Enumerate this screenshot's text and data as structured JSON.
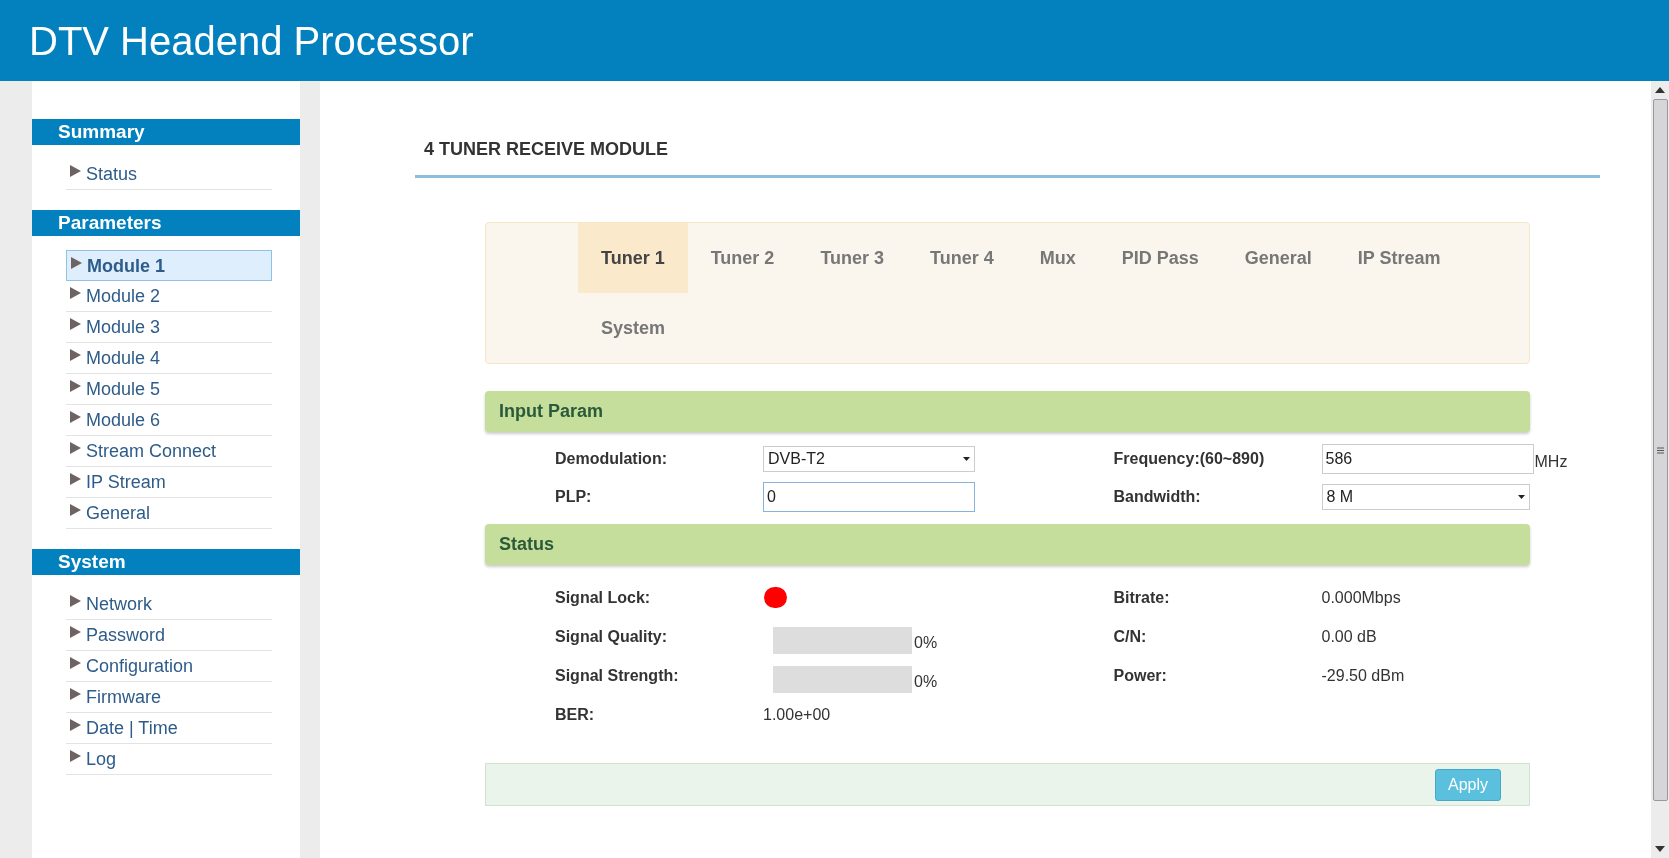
{
  "header": {
    "title": "DTV Headend Processor"
  },
  "sidebar": {
    "sections": [
      {
        "title": "Summary",
        "items": [
          {
            "label": "Status",
            "selected": false
          }
        ]
      },
      {
        "title": "Parameters",
        "items": [
          {
            "label": "Module 1",
            "selected": true
          },
          {
            "label": "Module 2",
            "selected": false
          },
          {
            "label": "Module 3",
            "selected": false
          },
          {
            "label": "Module 4",
            "selected": false
          },
          {
            "label": "Module 5",
            "selected": false
          },
          {
            "label": "Module 6",
            "selected": false
          },
          {
            "label": "Stream Connect",
            "selected": false
          },
          {
            "label": "IP Stream",
            "selected": false
          },
          {
            "label": "General",
            "selected": false
          }
        ]
      },
      {
        "title": "System",
        "items": [
          {
            "label": "Network",
            "selected": false
          },
          {
            "label": "Password",
            "selected": false
          },
          {
            "label": "Configuration",
            "selected": false
          },
          {
            "label": "Firmware",
            "selected": false
          },
          {
            "label": "Date | Time",
            "selected": false
          },
          {
            "label": "Log",
            "selected": false
          }
        ]
      }
    ]
  },
  "page_title": "4 TUNER RECEIVE MODULE",
  "tabs": [
    {
      "label": "Tuner 1",
      "selected": true
    },
    {
      "label": "Tuner 2",
      "selected": false
    },
    {
      "label": "Tuner 3",
      "selected": false
    },
    {
      "label": "Tuner 4",
      "selected": false
    },
    {
      "label": "Mux",
      "selected": false
    },
    {
      "label": "PID Pass",
      "selected": false
    },
    {
      "label": "General",
      "selected": false
    },
    {
      "label": "IP Stream",
      "selected": false
    },
    {
      "label": "System",
      "selected": false
    }
  ],
  "input_param": {
    "title": "Input Param",
    "fields": [
      {
        "label": "Demodulation:",
        "kind": "select",
        "value": "DVB-T2"
      },
      {
        "label": "Frequency:(60~890)",
        "kind": "input",
        "value": "586",
        "unit": "MHz"
      },
      {
        "label": "PLP:",
        "kind": "input",
        "value": "0",
        "focused": true
      },
      {
        "label": "Bandwidth:",
        "kind": "select",
        "value": "8 M"
      }
    ]
  },
  "status": {
    "title": "Status",
    "rows": [
      {
        "label": "Signal Lock:",
        "kind": "lamp",
        "locked": false
      },
      {
        "label": "Bitrate:",
        "kind": "text",
        "value": "0.000Mbps"
      },
      {
        "label": "Signal Quality:",
        "kind": "meter",
        "level": 0,
        "reading": "0%"
      },
      {
        "label": "C/N:",
        "kind": "text",
        "value": "0.00 dB"
      },
      {
        "label": "Signal Strength:",
        "kind": "meter",
        "level": 0,
        "reading": "0%"
      },
      {
        "label": "Power:",
        "kind": "text",
        "value": "-29.50 dBm"
      },
      {
        "label": "BER:",
        "kind": "text",
        "value": "1.00e+00"
      }
    ]
  },
  "apply_button": "Apply"
}
